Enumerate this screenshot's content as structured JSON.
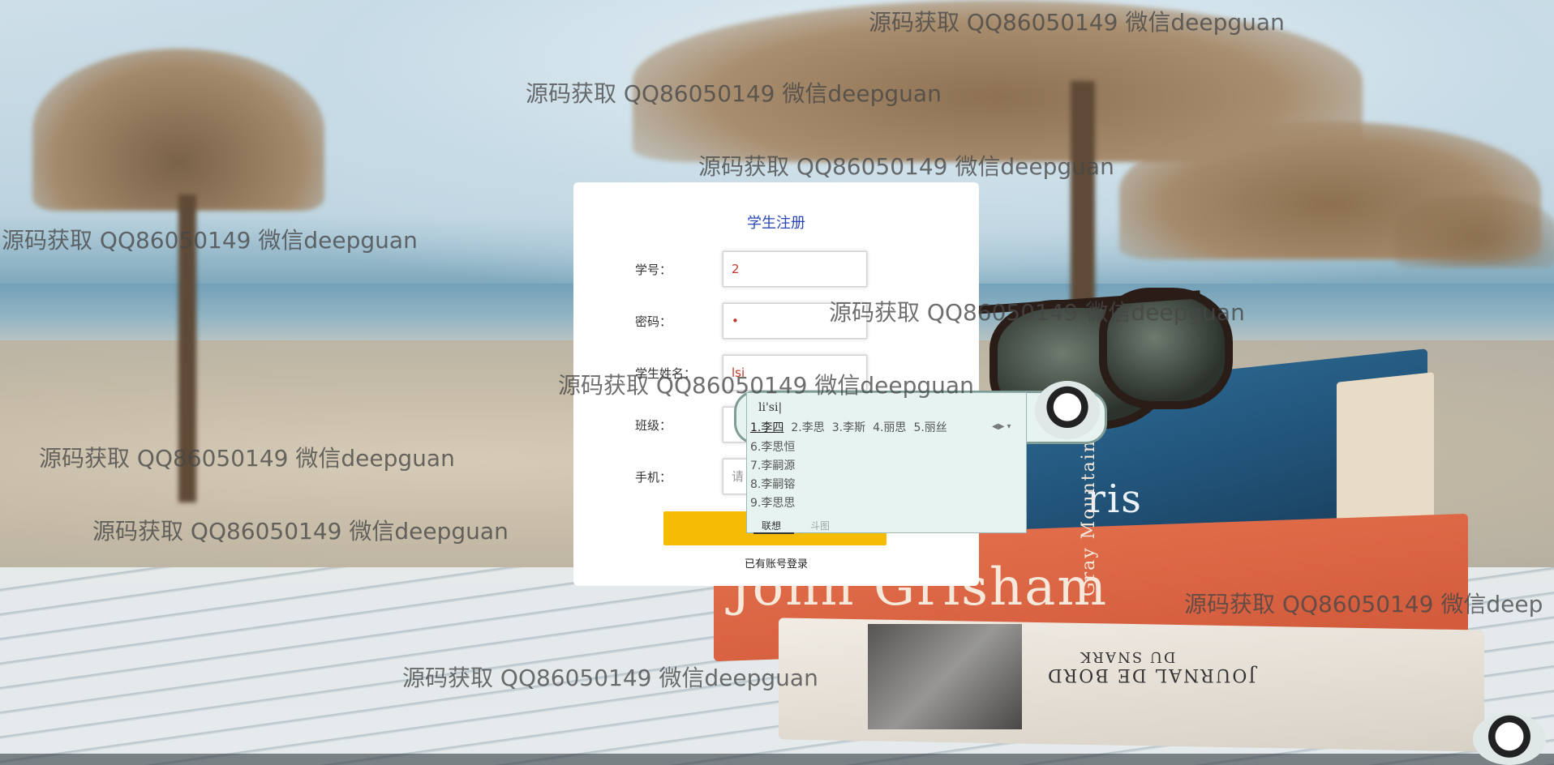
{
  "form": {
    "title": "学生注册",
    "fields": [
      {
        "label": "学号：",
        "value": "2",
        "placeholder": ""
      },
      {
        "label": "密码：",
        "value": "•",
        "placeholder": ""
      },
      {
        "label": "学生姓名：",
        "value": "lsi",
        "placeholder": ""
      },
      {
        "label": "班级：",
        "value": "",
        "placeholder": ""
      },
      {
        "label": "手机：",
        "value": "",
        "placeholder": "请"
      }
    ],
    "submit_label": "",
    "login_link": "已有账号登录"
  },
  "ime": {
    "pinyin": "li'si|",
    "candidates": [
      "1.李四",
      "2.李思",
      "3.李斯",
      "4.丽思",
      "5.丽丝"
    ],
    "more_candidates": [
      "6.李思恒",
      "7.李嗣源",
      "8.李嗣镕",
      "9.李思思"
    ],
    "tabs": [
      "联想",
      "斗图"
    ]
  },
  "background": {
    "book_title": "John Grisham",
    "book_spine": "Gray Mountain",
    "book_blue_text": "ris",
    "book_white_text": "JOURNAL DE BORD",
    "book_white_text2": "DU SNARK"
  },
  "watermarks": [
    "源码获取 QQ86050149 微信deepguan",
    "源码获取 QQ86050149 微信deepguan",
    "源码获取 QQ86050149 微信deepguan",
    "源码获取 QQ86050149 微信deepguan",
    "源码获取 QQ86050149 微信deepguan",
    "源码获取 QQ86050149 微信deepguan",
    "源码获取 QQ86050149 微信deepguan",
    "源码获取 QQ86050149 微信deepguan",
    "源码获取 QQ86050149 微信deepguan",
    "源码获取 QQ86050149 微信deep"
  ],
  "colors": {
    "title": "#2a47b8",
    "submit": "#f6bc05",
    "field_text": "#c0392b"
  }
}
